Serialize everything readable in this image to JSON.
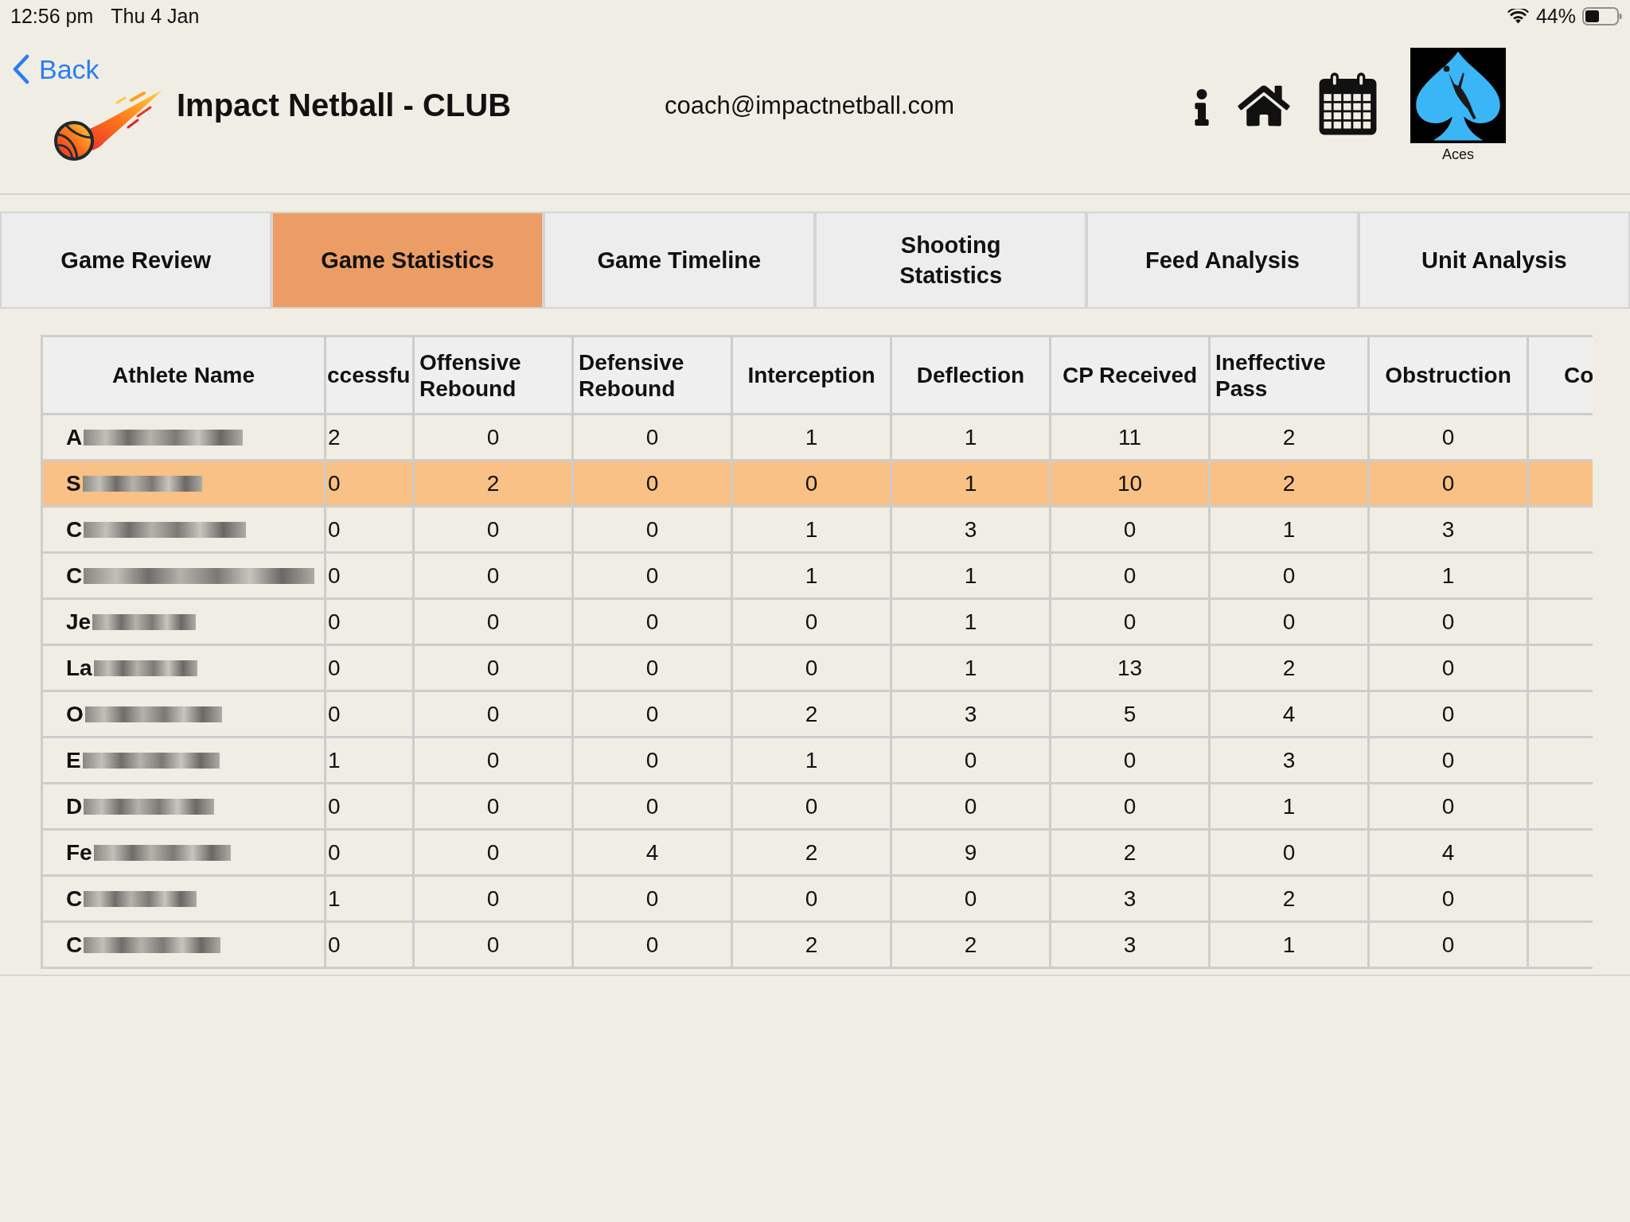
{
  "status_bar": {
    "time": "12:56 pm",
    "date": "Thu 4 Jan",
    "battery": "44%"
  },
  "header": {
    "back_label": "Back",
    "title": "Impact Netball - CLUB",
    "email": "coach@impactnetball.com",
    "team_label": "Aces"
  },
  "tabs": [
    {
      "label": "Game Review",
      "selected": false
    },
    {
      "label": "Game Statistics",
      "selected": true
    },
    {
      "label": "Game Timeline",
      "selected": false
    },
    {
      "label": "Shooting Statistics",
      "selected": false
    },
    {
      "label": "Feed Analysis",
      "selected": false
    },
    {
      "label": "Unit Analysis",
      "selected": false
    }
  ],
  "table": {
    "columns": [
      "Athlete Name",
      "ccessfu",
      "Offensive Rebound",
      "Defensive Rebound",
      "Interception",
      "Deflection",
      "CP Received",
      "Ineffective Pass",
      "Obstruction",
      "Co"
    ],
    "rows": [
      {
        "name": "A",
        "name_blurred": true,
        "selected": false,
        "values": [
          "2",
          "0",
          "0",
          "1",
          "1",
          "11",
          "2",
          "0"
        ]
      },
      {
        "name": "S",
        "name_blurred": true,
        "selected": true,
        "values": [
          "0",
          "2",
          "0",
          "0",
          "1",
          "10",
          "2",
          "0"
        ]
      },
      {
        "name": "C",
        "name_blurred": true,
        "selected": false,
        "values": [
          "0",
          "0",
          "0",
          "1",
          "3",
          "0",
          "1",
          "3"
        ]
      },
      {
        "name": "C",
        "name_blurred": true,
        "selected": false,
        "values": [
          "0",
          "0",
          "0",
          "1",
          "1",
          "0",
          "0",
          "1"
        ]
      },
      {
        "name": "Je",
        "name_blurred": true,
        "selected": false,
        "values": [
          "0",
          "0",
          "0",
          "0",
          "1",
          "0",
          "0",
          "0"
        ]
      },
      {
        "name": "La",
        "name_blurred": true,
        "selected": false,
        "values": [
          "0",
          "0",
          "0",
          "0",
          "1",
          "13",
          "2",
          "0"
        ]
      },
      {
        "name": "O",
        "name_blurred": true,
        "selected": false,
        "values": [
          "0",
          "0",
          "0",
          "2",
          "3",
          "5",
          "4",
          "0"
        ]
      },
      {
        "name": "E",
        "name_blurred": true,
        "selected": false,
        "values": [
          "1",
          "0",
          "0",
          "1",
          "0",
          "0",
          "3",
          "0"
        ]
      },
      {
        "name": "D",
        "name_blurred": true,
        "selected": false,
        "values": [
          "0",
          "0",
          "0",
          "0",
          "0",
          "0",
          "1",
          "0"
        ]
      },
      {
        "name": "Fe",
        "name_blurred": true,
        "selected": false,
        "values": [
          "0",
          "0",
          "4",
          "2",
          "9",
          "2",
          "0",
          "4"
        ]
      },
      {
        "name": "C",
        "name_blurred": true,
        "selected": false,
        "values": [
          "1",
          "0",
          "0",
          "0",
          "0",
          "3",
          "2",
          "0"
        ]
      },
      {
        "name": "C",
        "name_blurred": true,
        "selected": false,
        "values": [
          "0",
          "0",
          "0",
          "2",
          "2",
          "3",
          "1",
          "0"
        ]
      }
    ]
  }
}
